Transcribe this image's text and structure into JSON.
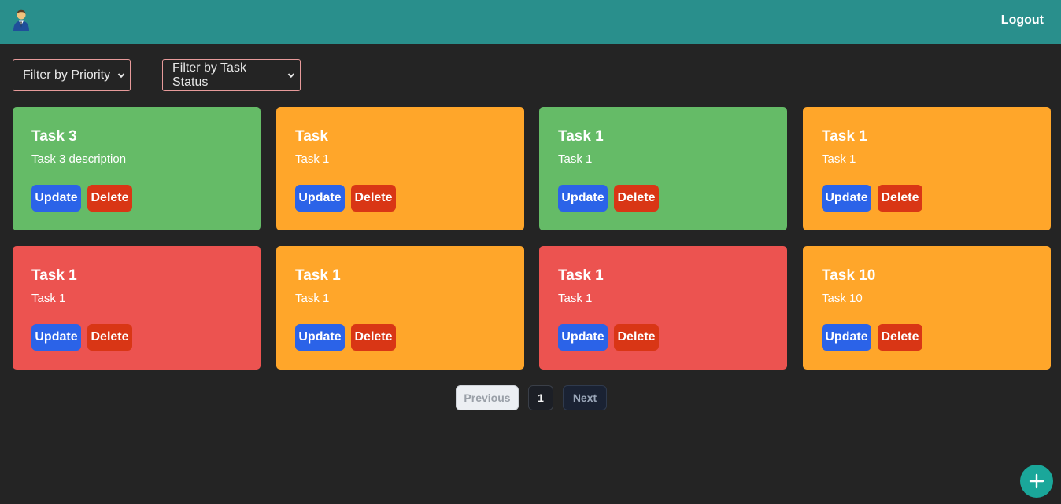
{
  "navbar": {
    "avatar_icon": "user-avatar-icon",
    "logout_label": "Logout",
    "background": "#298f8c"
  },
  "filters": {
    "priority": {
      "selected": "Filter by Priority"
    },
    "status": {
      "selected": "Filter by Task Status"
    }
  },
  "tasks": [
    {
      "title": "Task 3",
      "description": "Task 3 description",
      "color": "#65bb67"
    },
    {
      "title": "Task",
      "description": "Task 1",
      "color": "#ffa62a"
    },
    {
      "title": "Task 1",
      "description": "Task 1",
      "color": "#65bb67"
    },
    {
      "title": "Task 1",
      "description": "Task 1",
      "color": "#ffa62a"
    },
    {
      "title": "Task 1",
      "description": "Task 1",
      "color": "#ec5350"
    },
    {
      "title": "Task 1",
      "description": "Task 1",
      "color": "#ffa62a"
    },
    {
      "title": "Task 1",
      "description": "Task 1",
      "color": "#ec5350"
    },
    {
      "title": "Task 10",
      "description": "Task 10",
      "color": "#ffa62a"
    }
  ],
  "actions": {
    "update_label": "Update",
    "delete_label": "Delete"
  },
  "pagination": {
    "previous_label": "Previous",
    "current_page": "1",
    "next_label": "Next"
  },
  "fab": {
    "icon": "plus-icon",
    "color": "#1aa79a"
  }
}
